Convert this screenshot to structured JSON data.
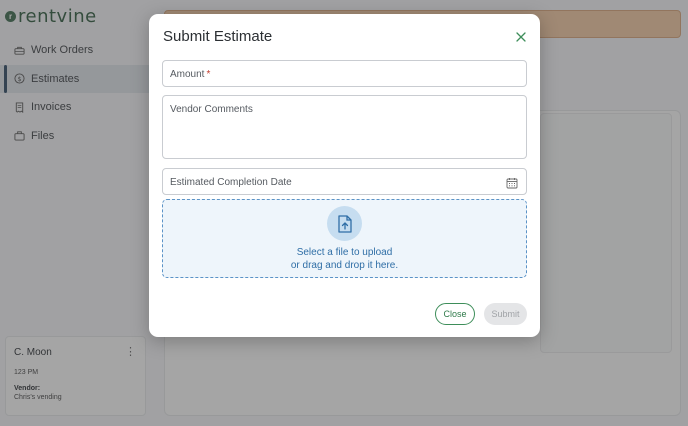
{
  "app": {
    "logo_text": "rentvine",
    "sidebar": {
      "items": [
        {
          "label": "Work Orders",
          "icon": "toolbox-icon",
          "active": false
        },
        {
          "label": "Estimates",
          "icon": "dollar-circle-icon",
          "active": true
        },
        {
          "label": "Invoices",
          "icon": "receipt-icon",
          "active": false
        },
        {
          "label": "Files",
          "icon": "briefcase-icon",
          "active": false
        }
      ]
    },
    "user_card": {
      "name": "C. Moon",
      "time": "123 PM",
      "vendor_label": "Vendor:",
      "vendor_name": "Chris's vending"
    }
  },
  "modal": {
    "title": "Submit Estimate",
    "fields": {
      "amount_label": "Amount",
      "amount_required_mark": "*",
      "comments_label": "Vendor Comments",
      "date_label": "Estimated Completion Date"
    },
    "upload": {
      "line1": "Select a file to upload",
      "line2": "or drag and drop it here."
    },
    "buttons": {
      "close": "Close",
      "submit": "Submit"
    }
  },
  "colors": {
    "brand_green": "#2e5a3e",
    "accent_blue": "#2f6ea6",
    "required_red": "#c0392b"
  }
}
